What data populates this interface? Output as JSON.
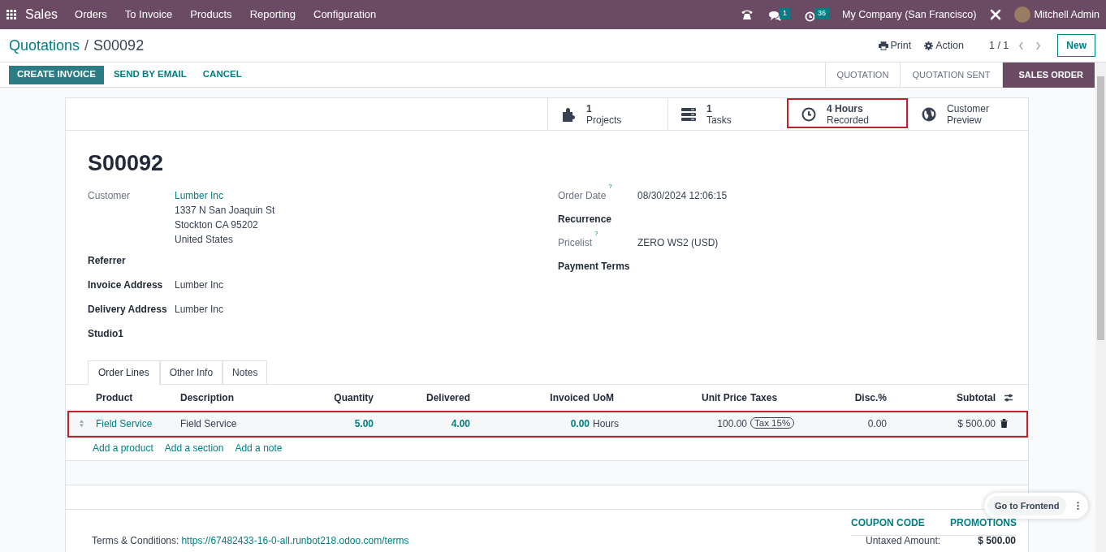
{
  "navbar": {
    "app": "Sales",
    "menu": [
      "Orders",
      "To Invoice",
      "Products",
      "Reporting",
      "Configuration"
    ],
    "messages_count": "1",
    "activities_count": "36",
    "company": "My Company (San Francisco)",
    "user": "Mitchell Admin"
  },
  "breadcrumb": {
    "parent": "Quotations",
    "separator": "/",
    "current": "S00092"
  },
  "control": {
    "print": "Print",
    "action": "Action",
    "pager": "1 / 1",
    "new": "New"
  },
  "actions": [
    {
      "label": "CREATE INVOICE",
      "primary": true
    },
    {
      "label": "SEND BY EMAIL",
      "primary": false
    },
    {
      "label": "CANCEL",
      "primary": false
    }
  ],
  "stages": [
    {
      "label": "QUOTATION",
      "selected": false
    },
    {
      "label": "QUOTATION SENT",
      "selected": false
    },
    {
      "label": "SALES ORDER",
      "selected": true
    }
  ],
  "stat_buttons": [
    {
      "kind": "puzzle",
      "value": "1",
      "label": "Projects",
      "highlighted": false
    },
    {
      "kind": "tasks",
      "value": "1",
      "label": "Tasks",
      "highlighted": false
    },
    {
      "kind": "clock",
      "value": "4 Hours",
      "label": "Recorded",
      "highlighted": true
    },
    {
      "kind": "globe",
      "value": "Customer",
      "label": "Preview",
      "highlighted": false
    }
  ],
  "title": "S00092",
  "left_fields": [
    {
      "label": "Customer",
      "bold": false,
      "value": "Lumber Inc",
      "link": true,
      "lines": [
        "1337 N San Joaquin St",
        "Stockton CA 95202",
        "United States"
      ]
    },
    {
      "label": "Referrer",
      "bold": true
    },
    {
      "label": "Invoice Address",
      "bold": true,
      "value": "Lumber Inc",
      "link": false
    },
    {
      "label": "Delivery Address",
      "bold": true,
      "value": "Lumber Inc",
      "link": false
    },
    {
      "label": "Studio1",
      "bold": true
    }
  ],
  "right_fields": [
    {
      "label": "Order Date",
      "bold": false,
      "help": "?",
      "value": "08/30/2024 12:06:15"
    },
    {
      "label": "Recurrence",
      "bold": true
    },
    {
      "label": "Pricelist",
      "bold": false,
      "help": "?",
      "value": "ZERO WS2 (USD)"
    },
    {
      "label": "Payment Terms",
      "bold": true
    }
  ],
  "tabs": [
    {
      "label": "Order Lines",
      "selected": true
    },
    {
      "label": "Other Info",
      "selected": false
    },
    {
      "label": "Notes",
      "selected": false
    }
  ],
  "table": {
    "columns": [
      "Product",
      "Description",
      "Quantity",
      "Delivered",
      "Invoiced",
      "UoM",
      "Unit Price",
      "Taxes",
      "Disc.%",
      "Subtotal"
    ],
    "rows": [
      {
        "highlighted": true,
        "cells": [
          "Field Service",
          "Field Service",
          "5.00",
          "4.00",
          "0.00",
          "Hours",
          "100.00",
          "Tax 15%",
          "0.00",
          "$ 500.00"
        ]
      }
    ],
    "add_links": [
      "Add a product",
      "Add a section",
      "Add a note"
    ]
  },
  "floating": {
    "label": "Go to Frontend"
  },
  "footer": {
    "buttons": [
      "COUPON CODE",
      "PROMOTIONS"
    ],
    "terms_label": "Terms & Conditions:",
    "terms_link": "https://67482433-16-0-all.runbot218.odoo.com/terms",
    "total_label": "Untaxed Amount:",
    "total_value": "$ 500.00"
  }
}
